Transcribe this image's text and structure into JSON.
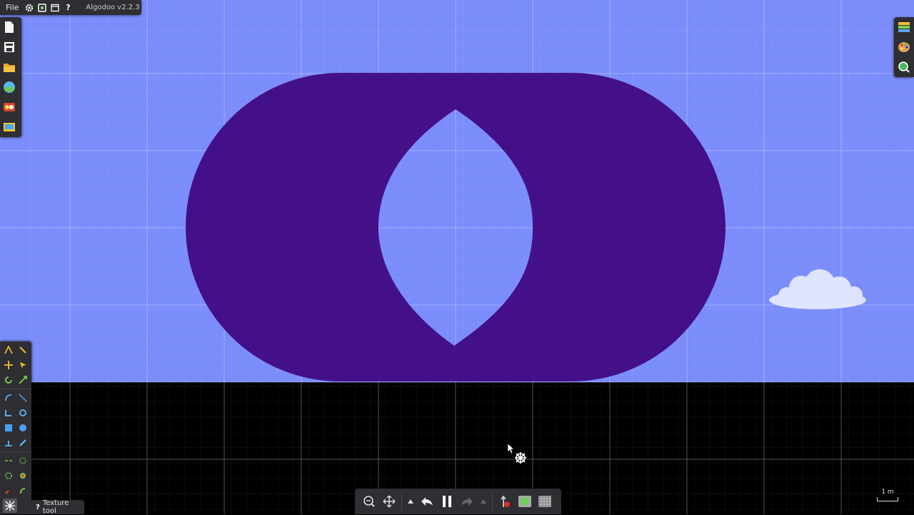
{
  "menu": {
    "file_label": "File",
    "app_title": "Algodoo v2.2.3",
    "icons": [
      "gear-icon",
      "screen-icon",
      "window-icon",
      "help-icon"
    ]
  },
  "left_toolbar": {
    "items": [
      "new-scene-icon",
      "save-icon",
      "open-folder-icon",
      "scene-browser-icon",
      "lessons-icon",
      "online-icon"
    ]
  },
  "right_toolbar": {
    "items": [
      "options-icon",
      "palette-icon",
      "zoom-icon"
    ]
  },
  "tools_panel": {
    "items": [
      "sketch-tool",
      "cut-tool",
      "move-tool",
      "drag-tool",
      "rotate-tool",
      "scale-tool",
      "rope-tool",
      "spring-tool",
      "fixate-tool",
      "hinge-tool",
      "box-tool",
      "circle-tool",
      "plane-tool",
      "pen-tool",
      "gear-tool",
      "thruster-tool",
      "chain-tool",
      "tracer-tool",
      "laser-tool",
      "eraser-tool",
      "texture-tool"
    ]
  },
  "status_hint": {
    "label": "Texture tool",
    "icon": "question-icon"
  },
  "bottom_bar": {
    "items": [
      "zoom-icon",
      "pan-icon",
      "undo-menu-icon",
      "undo-icon",
      "pause-icon",
      "redo-icon",
      "redo-menu-icon",
      "gravity-icon",
      "air-icon",
      "grid-icon"
    ]
  },
  "scale_label": "1 m",
  "colors": {
    "sky": "#7b8cfb",
    "ground": "#000000",
    "shape": "#3f0680",
    "toolbar": "#2e2e33"
  }
}
